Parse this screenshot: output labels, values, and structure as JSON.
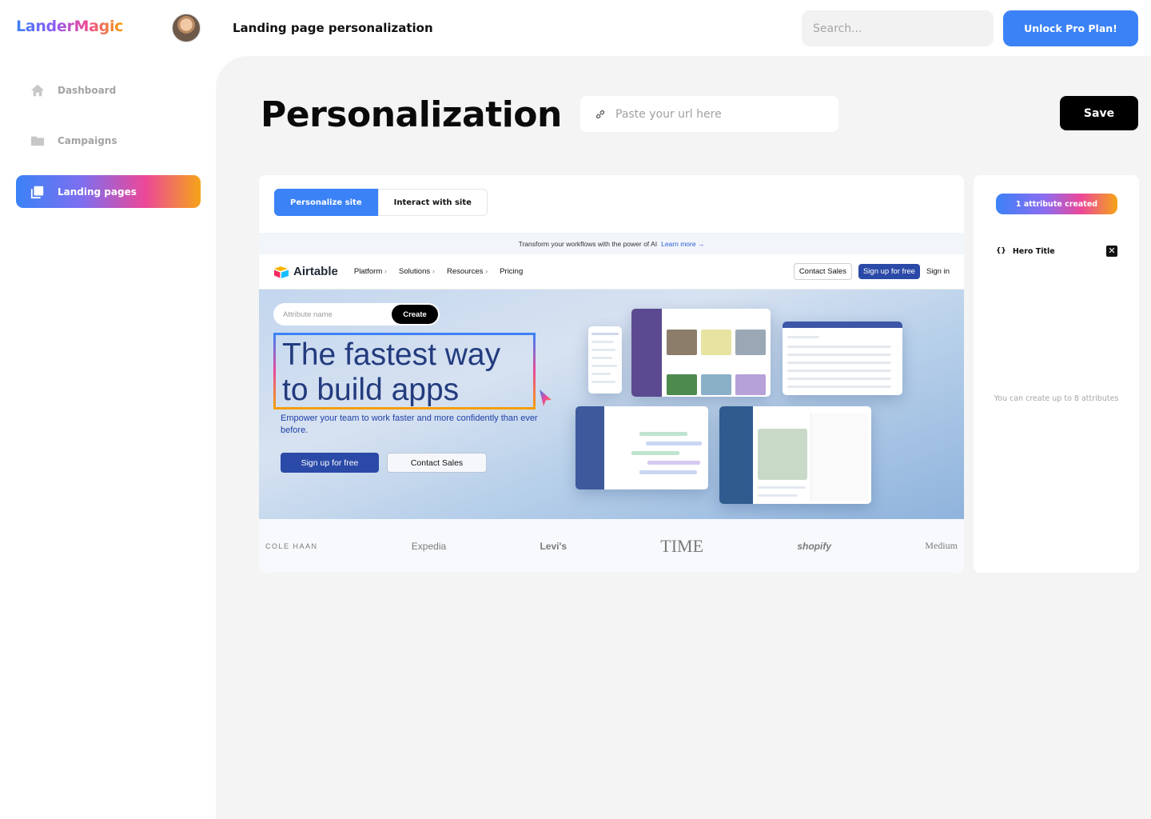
{
  "app": {
    "logo": "LanderMagic",
    "page_heading": "Landing page personalization",
    "search_placeholder": "Search...",
    "upgrade_label": "Unlock Pro Plan!"
  },
  "sidebar": {
    "items": [
      {
        "label": "Dashboard",
        "icon": "home-icon",
        "active": false
      },
      {
        "label": "Campaigns",
        "icon": "folder-icon",
        "active": false
      },
      {
        "label": "Landing pages",
        "icon": "pages-icon",
        "active": true
      }
    ]
  },
  "main": {
    "title": "Personalization",
    "url_placeholder": "Paste your url here",
    "save_label": "Save"
  },
  "preview": {
    "tabs": [
      "Personalize site",
      "Interact with site"
    ],
    "active_tab": "Personalize site",
    "site": {
      "banner_text": "Transform your workflows with the power of AI",
      "banner_link": "Learn more →",
      "brand": "Airtable",
      "menu": [
        "Platform",
        "Solutions",
        "Resources",
        "Pricing"
      ],
      "nav_contact": "Contact Sales",
      "nav_signup": "Sign up for free",
      "nav_signin": "Sign in",
      "attribute_placeholder": "Attribute name",
      "create_label": "Create",
      "hero_title": "The fastest way to build apps",
      "hero_subtitle": "Empower your team to work faster and more confidently than ever before.",
      "hero_cta_primary": "Sign up for free",
      "hero_cta_secondary": "Contact Sales",
      "customer_logos": [
        "COLE HAAN",
        "Expedia",
        "Levi's",
        "TIME",
        "shopify",
        "Medium"
      ]
    }
  },
  "attributes": {
    "badge": "1 attribute created",
    "items": [
      {
        "label": "Hero Title"
      }
    ],
    "note": "You can create up to 8 attributes"
  },
  "colors": {
    "accent": "#3b82f6",
    "gradient": [
      "#3b82f6",
      "#8b5cf6",
      "#ec4899",
      "#f59e0b"
    ],
    "save_bg": "#000000"
  }
}
